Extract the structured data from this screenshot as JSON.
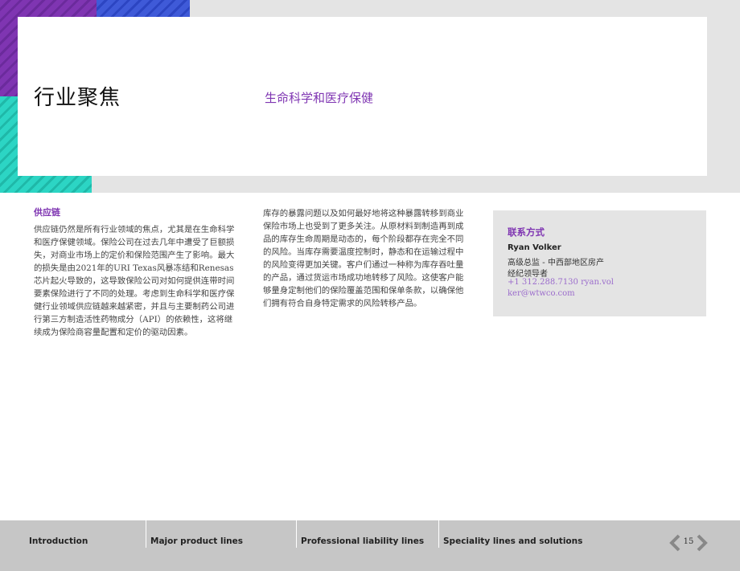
{
  "hero": {
    "title": "行业聚焦",
    "subtitle": "生命科学和医疗保健"
  },
  "section": {
    "heading": "供应链",
    "column_1": "供应链仍然是所有行业领域的焦点，尤其是在生命科学和医疗保健领域。保险公司在过去几年中遭受了巨额损失，对商业市场上的定价和保险范围产生了影响。最大的损失是由2021年的URI Texas风暴冻结和Renesas芯片起火导致的，这导致保险公司对如何提供连带时间要素保险进行了不同的处理。考虑到生命科学和医疗保健行业领域供应链越来越紧密，并且与主要制药公司进行第三方制造活性药物成分（API）的依赖性，这将继续成为保险商容量配置和定价的驱动因素。",
    "column_2": "库存的暴露问题以及如何最好地将这种暴露转移到商业保险市场上也受到了更多关注。从原材料到制造再到成品的库存生命周期是动态的，每个阶段都存在完全不同的风险。当库存需要温度控制时，静态和在运输过程中的风险变得更加关键。客户们通过一种称为库存吞吐量的产品，通过货运市场成功地转移了风险。这使客户能够量身定制他们的保险覆盖范围和保单条款，以确保他们拥有符合自身特定需求的风险转移产品。"
  },
  "contact": {
    "heading": "联系方式",
    "name": "Ryan Volker",
    "title_line_1": "高级总监 - 中西部地区房产",
    "title_line_2": "经纪领导者",
    "phone_email": "+1 312.288.7130 ryan.volker@wtwco.com"
  },
  "footer": {
    "nav": [
      "Introduction",
      "Major product lines",
      "Professional liability lines",
      "Speciality lines and solutions"
    ],
    "page_number": "15"
  },
  "colors": {
    "accent_purple": "#7f35b2",
    "teal": "#2cd5c4",
    "blue": "#3f5ad8",
    "band_grey": "#e4e4e4",
    "footer_grey": "#c6c6c6"
  }
}
